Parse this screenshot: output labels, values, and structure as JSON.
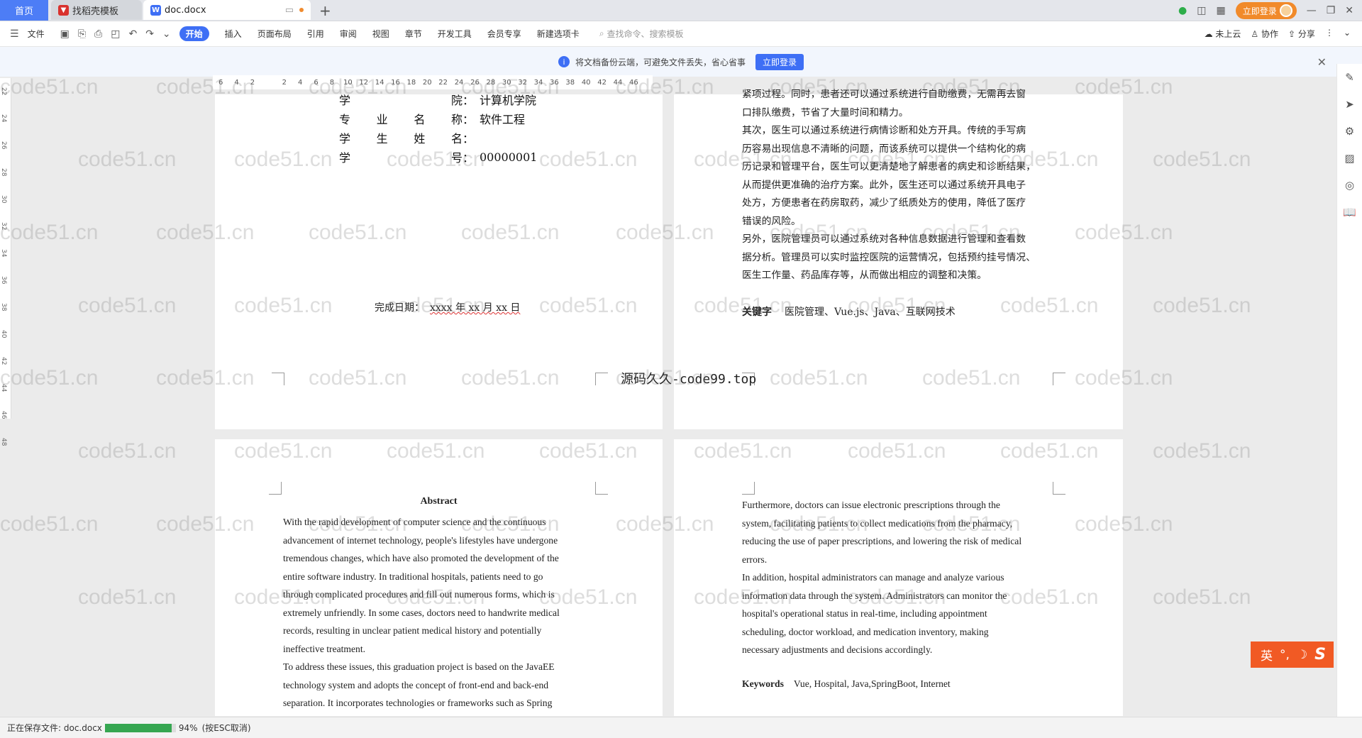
{
  "tabs": {
    "home": "首页",
    "template": "找稻壳模板",
    "doc": "doc.docx"
  },
  "header_right": {
    "login": "立即登录"
  },
  "toolbar": {
    "file": "文件",
    "start": "开始",
    "items": [
      "插入",
      "页面布局",
      "引用",
      "审阅",
      "视图",
      "章节",
      "开发工具",
      "会员专享",
      "新建选项卡"
    ],
    "search_placeholder": "查找命令、搜索模板",
    "cloud": "未上云",
    "collab": "协作",
    "share": "分享"
  },
  "notification": {
    "text": "将文档备份云端，可避免文件丢失，省心省事",
    "button": "立即登录"
  },
  "ruler": [
    "6",
    "4",
    "2",
    "",
    "2",
    "4",
    "6",
    "8",
    "10",
    "12",
    "14",
    "16",
    "18",
    "20",
    "22",
    "24",
    "26",
    "28",
    "30",
    "32",
    "34",
    "36",
    "38",
    "40",
    "42",
    "44",
    "46"
  ],
  "left_ruler": [
    "22",
    "24",
    "26",
    "28",
    "30",
    "32",
    "34",
    "36",
    "38",
    "40",
    "42",
    "44",
    "46",
    "48"
  ],
  "page1": {
    "rows": [
      {
        "key": "学院",
        "key_chars": [
          "学",
          "院："
        ],
        "value": "计算机学院"
      },
      {
        "key": "专业名称",
        "key_chars": [
          "专",
          "业",
          "名",
          "称："
        ],
        "value": "软件工程"
      },
      {
        "key": "学生姓名",
        "key_chars": [
          "学",
          "生",
          "姓",
          "名："
        ],
        "value": ""
      },
      {
        "key": "学号",
        "key_chars": [
          "学",
          "号："
        ],
        "value": "00000001"
      }
    ],
    "date_label": "完成日期：",
    "date_value": "xxxx 年 xx 月 xx 日"
  },
  "page2": {
    "paragraphs": [
      "紧项过程。同时，患者还可以通过系统进行自助缴费，无需再去窗",
      "口排队缴费，节省了大量时间和精力。",
      "其次，医生可以通过系统进行病情诊断和处方开具。传统的手写病",
      "历容易出现信息不清晰的问题，而该系统可以提供一个结构化的病",
      "历记录和管理平台，医生可以更清楚地了解患者的病史和诊断结果，",
      "从而提供更准确的治疗方案。此外，医生还可以通过系统开具电子",
      "处方，方便患者在药房取药，减少了纸质处方的使用，降低了医疗",
      "错误的风险。",
      "另外，医院管理员可以通过系统对各种信息数据进行管理和查看数",
      "据分析。管理员可以实时监控医院的运营情况，包括预约挂号情况、",
      "医生工作量、药品库存等，从而做出相应的调整和决策。"
    ],
    "keywords_label": "关键字",
    "keywords_value": "医院管理、Vue.js、Java、互联网技术"
  },
  "center_mark": "源码久久-code99.top",
  "page3": {
    "title": "Abstract",
    "lines": [
      "With the rapid development of computer science and the continuous",
      "advancement of internet technology, people's lifestyles have undergone",
      "tremendous changes, which have also promoted the development of the",
      "entire software industry. In traditional hospitals, patients need to go",
      "through complicated procedures and fill out numerous forms, which is",
      "extremely unfriendly. In some cases, doctors need to handwrite medical",
      "records, resulting in unclear patient medical history and potentially",
      "ineffective treatment.",
      "To address these issues, this graduation project is based on the JavaEE",
      "technology system and adopts the concept of front-end and back-end",
      "separation. It incorporates technologies or frameworks such as Spring"
    ]
  },
  "page4": {
    "lines": [
      "Furthermore, doctors can issue electronic prescriptions through the",
      "system, facilitating patients to collect medications from the pharmacy,",
      "reducing the use of paper prescriptions, and lowering the risk of medical",
      "errors.",
      "In addition, hospital administrators can manage and analyze various",
      "information data through the system. Administrators can monitor the",
      "hospital's operational status in real-time, including appointment",
      "scheduling, doctor workload, and medication inventory, making",
      "necessary adjustments and decisions accordingly."
    ],
    "keywords_label": "Keywords",
    "keywords_value": "Vue, Hospital, Java,SpringBoot, Internet"
  },
  "watermark": "code51.cn",
  "status": {
    "saving": "正在保存文件: doc.docx",
    "progress": 0.94,
    "percent": "94%",
    "hint": "(按ESC取消)"
  },
  "ime": {
    "label": "英"
  },
  "colors": {
    "accent": "#3e6ff5",
    "ime": "#f15a24",
    "progress": "#36a651"
  }
}
